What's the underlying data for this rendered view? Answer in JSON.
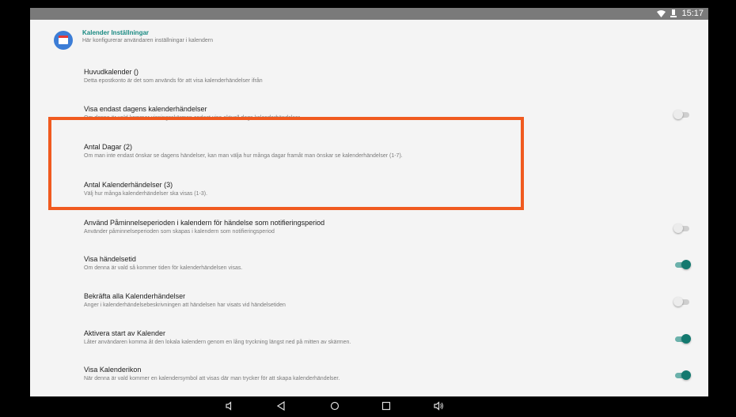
{
  "status": {
    "time": "15:17",
    "wifi_icon": "wifi-icon",
    "signal_icon": "signal-icon"
  },
  "header": {
    "title": "Kalender Inställningar",
    "subtitle": "Här konfigurerar användaren inställningar i kalendern",
    "icon": "calendar-icon"
  },
  "settings": [
    {
      "title": "Huvudkalender ()",
      "summary": "Detta epostkonto är det som används för att visa kalenderhändelser ifrån"
    },
    {
      "title": "Visa endast dagens kalenderhändelser",
      "summary": "Om denna är vald kommer visningsskärmen endast visa aktuell dags kalenderhändelser.",
      "toggle": false
    },
    {
      "title": "Antal Dagar (2)",
      "summary": "Om man inte endast önskar se dagens händelser, kan man välja hur många dagar framåt man önskar se kalenderhändelser (1-7)."
    },
    {
      "title": "Antal Kalenderhändelser (3)",
      "summary": "Välj hur många kalenderhändelser ska visas (1-3)."
    },
    {
      "title": "Använd Påminnelseperioden i kalendern för händelse som notifieringsperiod",
      "summary": "Använder påminnelseperioden som skapas i kalendern som notifieringsperiod",
      "toggle": false
    },
    {
      "title": "Visa händelsetid",
      "summary": "Om denna är vald så kommer tiden för kalenderhändelsen visas.",
      "toggle": true
    },
    {
      "title": "Bekräfta alla Kalenderhändelser",
      "summary": "Anger i kalenderhändelsebeskrivningen att händelsen har visats vid händelsetiden",
      "toggle": false
    },
    {
      "title": "Aktivera start av Kalender",
      "summary": "Låter användaren komma åt den lokala kalendern genom en lång tryckning längst ned på mitten av skärmen.",
      "toggle": true
    },
    {
      "title": "Visa Kalenderikon",
      "summary": "När denna är vald kommer en kalendersymbol att visas där man trycker för att skapa kalenderhändelser.",
      "toggle": true
    }
  ],
  "colors": {
    "accent": "#13796f",
    "highlight": "#f05a1f",
    "header_title": "#1a8a82"
  },
  "navbar": [
    "volume-down-icon",
    "back-icon",
    "home-icon",
    "recents-icon",
    "volume-up-icon"
  ]
}
